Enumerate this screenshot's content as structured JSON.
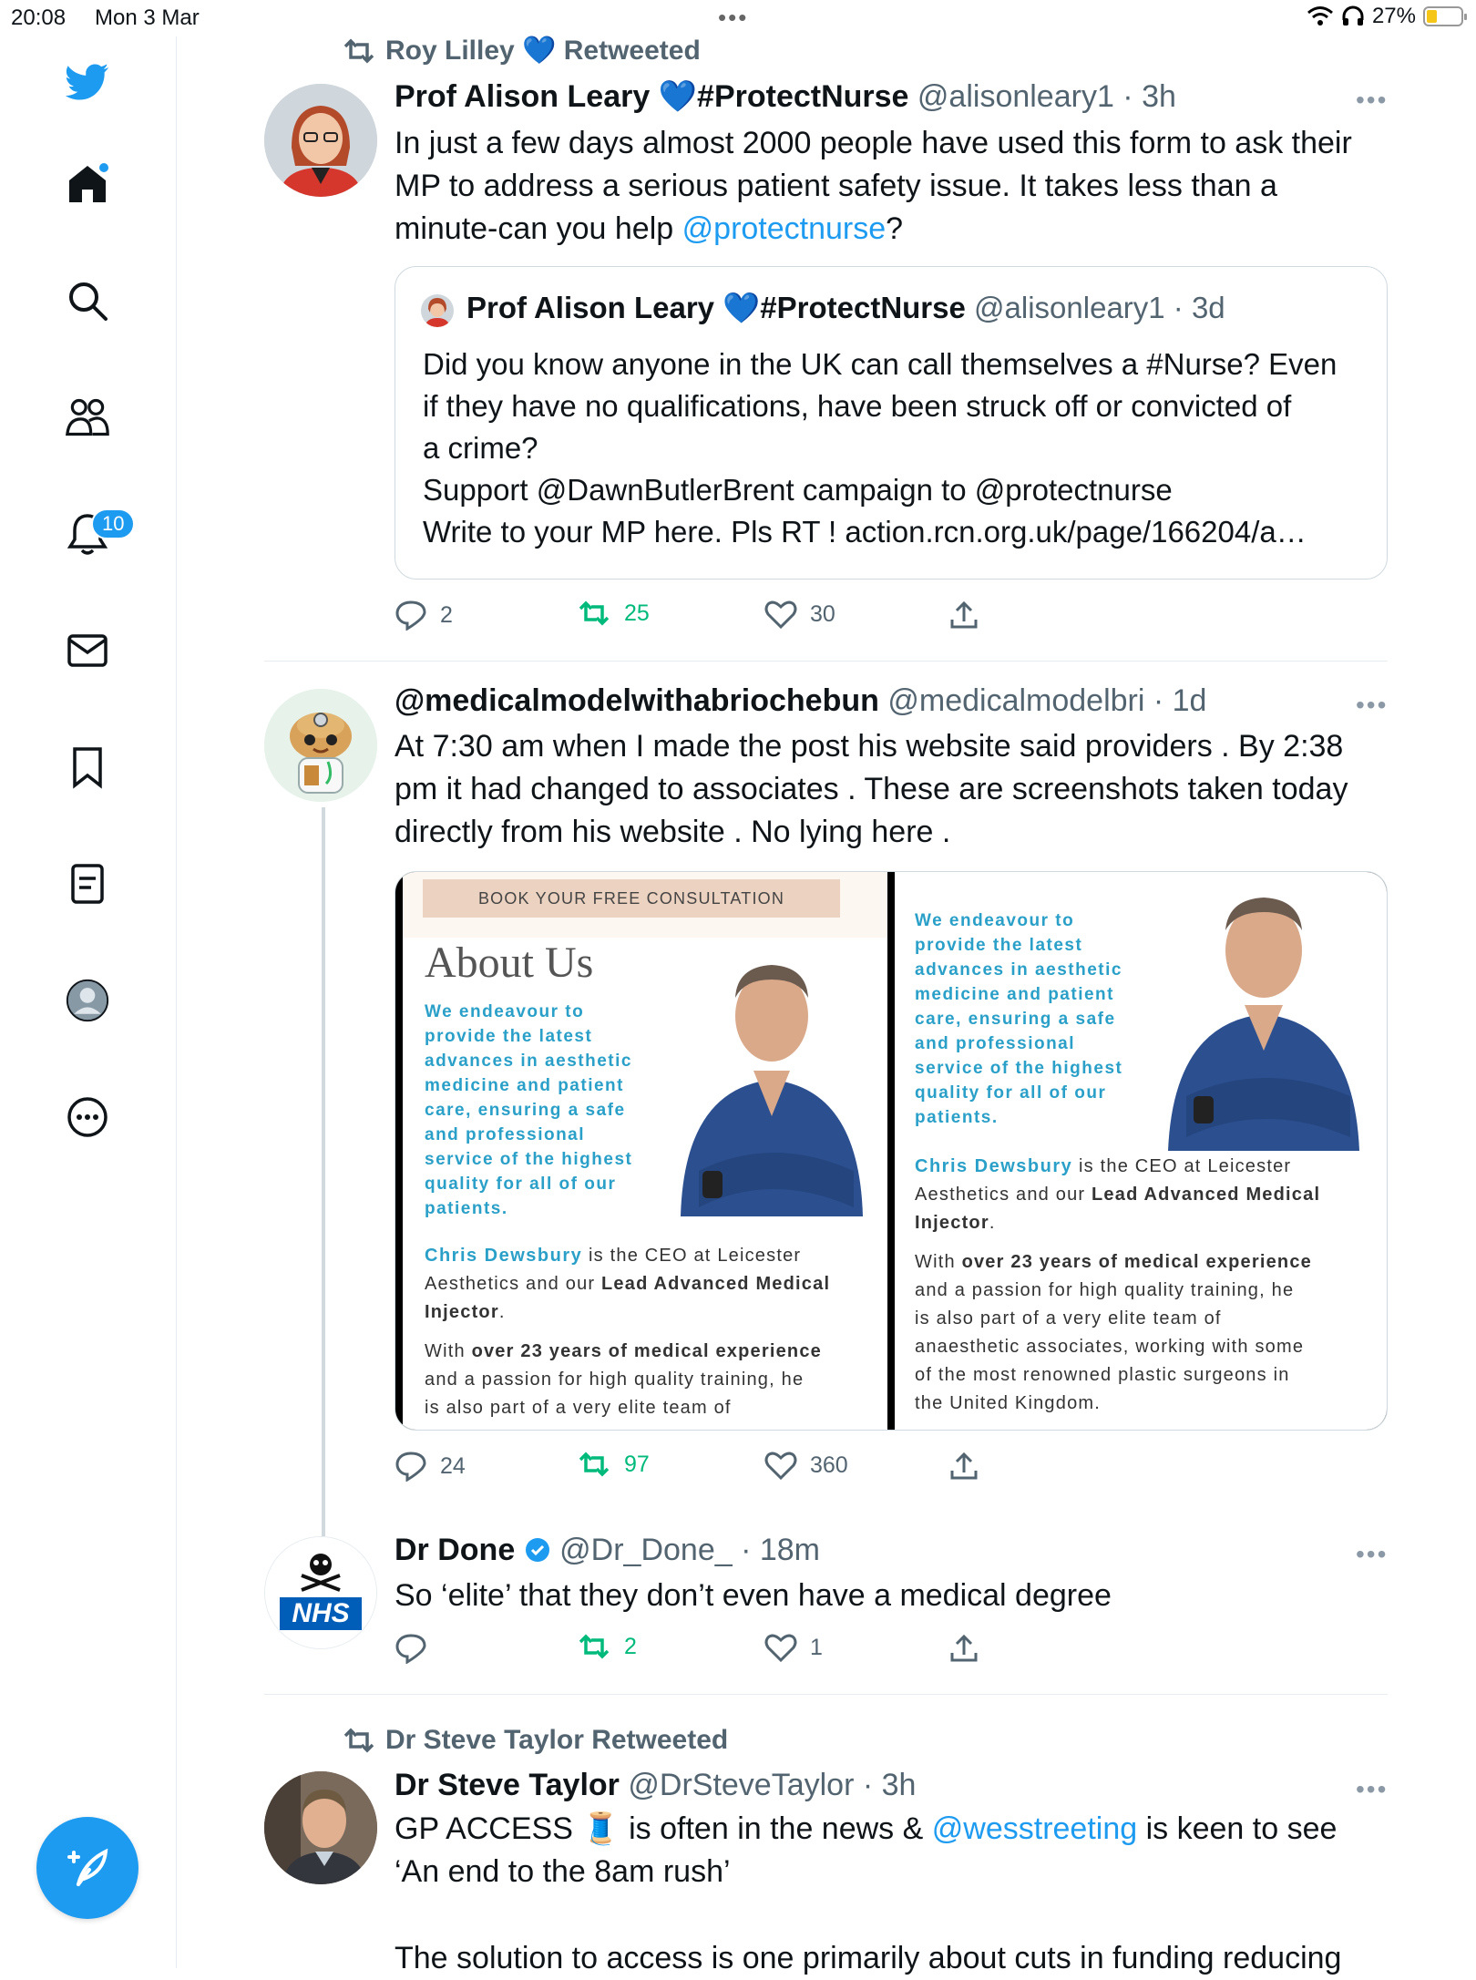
{
  "status_bar": {
    "time": "20:08",
    "date": "Mon 3 Mar",
    "battery": "27%",
    "battery_level": 0.27
  },
  "sidebar": {
    "notifications_badge": "10",
    "items": [
      "twitter-logo",
      "home-icon",
      "search-icon",
      "communities-icon",
      "notifications-icon",
      "messages-icon",
      "bookmarks-icon",
      "lists-icon",
      "profile-icon",
      "more-icon"
    ]
  },
  "colors": {
    "accent": "#1d9bf0",
    "retweet": "#00ba7c",
    "muted": "#536471"
  },
  "tweets": [
    {
      "context": "Roy Lilley 💙 Retweeted",
      "name": "Prof Alison Leary 💙#ProtectNurse",
      "handle": "@alisonleary1 · 3h",
      "text_before": "In just a few days almost 2000 people have used this form to ask their MP to address a serious patient safety issue.  It takes less than a minute-can you help ",
      "mention": "@protectnurse",
      "text_after": "?",
      "quote": {
        "name": "Prof Alison Leary 💙#ProtectNurse",
        "handle": "@alisonleary1 · 3d",
        "line1": "Did you know anyone in the UK can call themselves a #Nurse? Even",
        "line2": "if they have no qualifications, have been struck off or convicted of",
        "line3": "a crime?",
        "line4": "Support @DawnButlerBrent campaign to @protectnurse",
        "line5": "Write to your MP here. Pls RT ! action.rcn.org.uk/page/166204/a…"
      },
      "replies": "2",
      "retweets": "25",
      "likes": "30"
    },
    {
      "name": "@medicalmodelwithabriochebun",
      "handle": "@medicalmodelbri · 1d",
      "text": "At 7:30 am when I made the post his website said providers . By 2:38 pm it had changed to associates . These are screenshots taken today directly from his website . No lying here .",
      "media": {
        "left": {
          "banner": "BOOK YOUR FREE CONSULTATION",
          "heading": "About Us",
          "blue1": "We endeavour to",
          "blue2": "provide the latest",
          "blue3": "advances in aesthetic",
          "blue4": "medicine and patient",
          "blue5": "care, ensuring a safe",
          "blue6": "and professional",
          "blue7": "service of the highest",
          "blue8": "quality for all of our",
          "blue9": "patients.",
          "name": "Chris Dewsbury",
          "p1a": " is the CEO at Leicester",
          "p1b": "Aesthetics and our ",
          "p1c": "Lead Advanced Medical",
          "p1d": "Injector",
          "p2a": "With ",
          "p2b": "over 23 years of medical experience",
          "p2c": "and a passion for high quality training, he",
          "p2d": "is also part of a very elite team of"
        },
        "right": {
          "blue1": "We endeavour to",
          "blue2": "provide the latest",
          "blue3": "advances in aesthetic",
          "blue4": "medicine and patient",
          "blue5": "care, ensuring a safe",
          "blue6": "and professional",
          "blue7": "service of the highest",
          "blue8": "quality for all of our",
          "blue9": "patients.",
          "name": "Chris Dewsbury",
          "p1a": " is the CEO at Leicester",
          "p1b": "Aesthetics and our ",
          "p1c": "Lead Advanced Medical",
          "p1d": "Injector",
          "p2a": "With ",
          "p2b": "over 23 years of medical experience",
          "p2c": "and a passion for high quality training, he",
          "p2d": "is also part of a very elite team of",
          "p2e": "anaesthetic associates, working with some",
          "p2f": "of the most renowned plastic surgeons in",
          "p2g": "the United Kingdom."
        }
      },
      "replies": "24",
      "retweets": "97",
      "likes": "360"
    },
    {
      "name": "Dr Done",
      "handle": "@Dr_Done_ · 18m",
      "avatar_text": "NHS",
      "text": "So ‘elite’ that they don’t even have a medical degree",
      "replies": "",
      "retweets": "2",
      "likes": "1"
    },
    {
      "context": "Dr Steve Taylor Retweeted",
      "name": "Dr Steve Taylor",
      "handle": "@DrSteveTaylor · 3h",
      "text_before": "GP ACCESS 🧵 is often in the news & ",
      "mention": "@wesstreeting",
      "text_after": " is keen to see ‘An end to the 8am rush’",
      "text_more": "The solution to access is one primarily about cuts in funding reducing"
    }
  ]
}
